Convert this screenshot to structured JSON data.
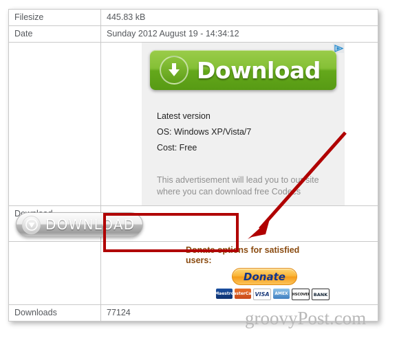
{
  "table": {
    "rows": [
      {
        "label": "Filesize",
        "value": "445.83 kB"
      },
      {
        "label": "Date",
        "value": "Sunday 2012 August 19 - 14:34:12"
      },
      {
        "label": "Download",
        "value": ""
      },
      {
        "label": "Downloads",
        "value": "77124"
      }
    ]
  },
  "advertisement": {
    "adchoices_icon": "adchoices-triangle-icon",
    "button_label": "Download",
    "button_icon": "download-arrow-icon",
    "line1": "Latest version",
    "line2": "OS: Windows XP/Vista/7",
    "line3": "Cost: Free",
    "disclaimer": "This advertisement will lead you to our site where you can download free Codecs"
  },
  "download_row": {
    "label": "Download",
    "button_label": "DOWNLOAD",
    "button_icon": "download-triangle-icon",
    "highlight_color": "#b00000",
    "annotation_arrow": "red-arrow-pointing-to-download-button"
  },
  "donate": {
    "heading": "Donate options for satisfied users:",
    "button_label": "Donate",
    "cards": [
      {
        "name": "maestro-card-icon",
        "label": "Maestro"
      },
      {
        "name": "mastercard-card-icon",
        "label": "MasterCard"
      },
      {
        "name": "visa-card-icon",
        "label": "VISA"
      },
      {
        "name": "amex-card-icon",
        "label": "AMEX"
      },
      {
        "name": "discover-card-icon",
        "label": "DISCOVER"
      },
      {
        "name": "bank-card-icon",
        "label": "BANK"
      }
    ]
  },
  "watermark": "groovyPost.com"
}
